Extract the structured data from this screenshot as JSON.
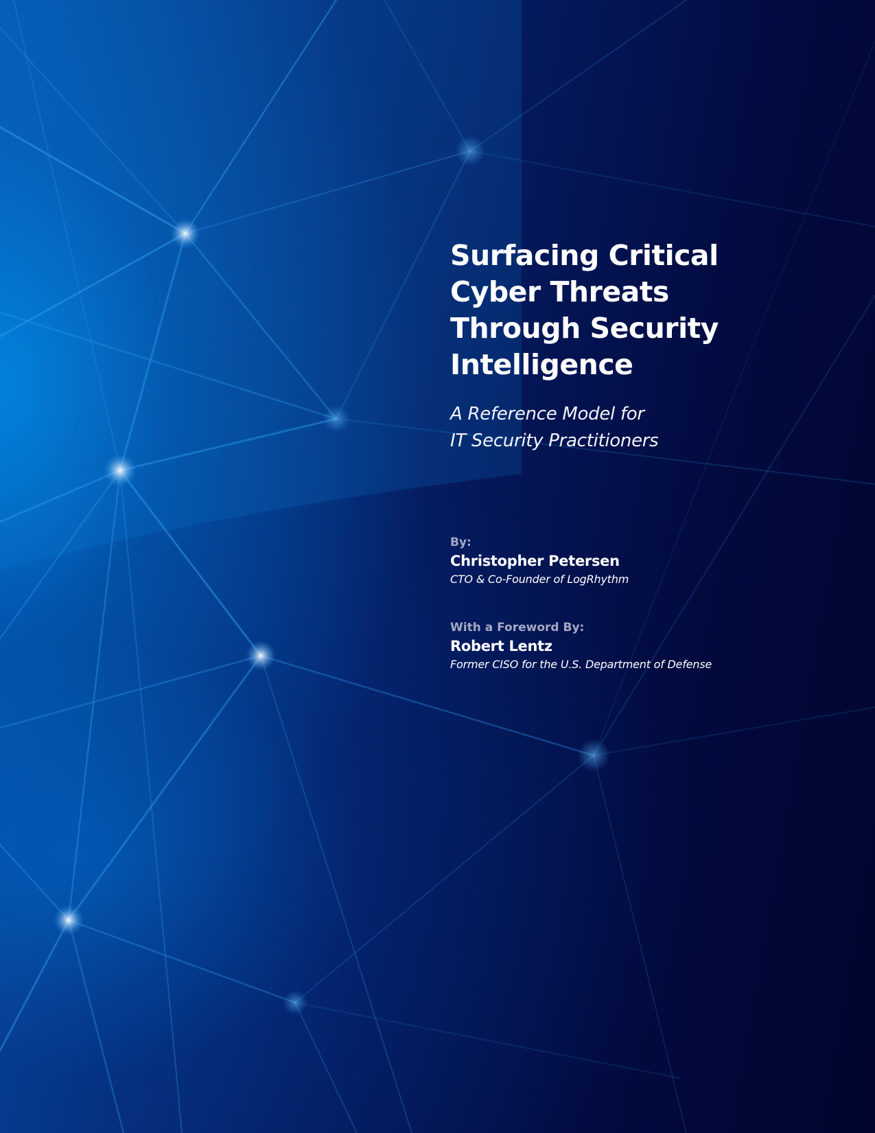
{
  "cover": {
    "title_lines": [
      "Surfacing Critical",
      "Cyber Threats",
      "Through Security",
      "Intelligence"
    ],
    "subtitle_lines": [
      "A Reference Model for",
      "IT Security Practitioners"
    ],
    "author": {
      "label": "By:",
      "name": "Christopher Petersen",
      "role": "CTO & Co-Founder of LogRhythm"
    },
    "foreword": {
      "label": "With a Foreword By:",
      "name": "Robert Lentz",
      "role": "Former CISO for the U.S. Department of Defense"
    }
  },
  "colors": {
    "background_light": "#0a7fd6",
    "background_dark": "#01052e",
    "network_line": "#2e9bea",
    "node_glow": "#d8ecff",
    "label_gray": "#a6a9c4",
    "text_white": "#ffffff"
  }
}
